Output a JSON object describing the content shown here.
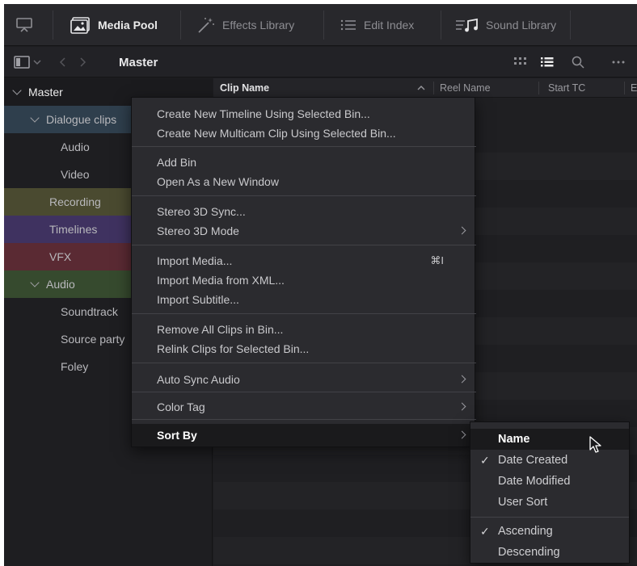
{
  "toolbar": {
    "tabs": [
      {
        "label": "Media Pool",
        "icon": "media-pool-icon",
        "active": true
      },
      {
        "label": "Effects Library",
        "icon": "effects-wand-icon",
        "active": false
      },
      {
        "label": "Edit Index",
        "icon": "list-index-icon",
        "active": false
      },
      {
        "label": "Sound Library",
        "icon": "music-note-icon",
        "active": false
      }
    ]
  },
  "subbar": {
    "title": "Master"
  },
  "columns": {
    "clip_name": "Clip Name",
    "reel_name": "Reel Name",
    "start_tc": "Start TC",
    "end_tc": "E"
  },
  "sidebar": {
    "items": [
      {
        "label": "Master"
      },
      {
        "label": "Dialogue clips"
      },
      {
        "label": "Audio"
      },
      {
        "label": "Video"
      },
      {
        "label": "Recording"
      },
      {
        "label": "Timelines"
      },
      {
        "label": "VFX"
      },
      {
        "label": "Audio"
      },
      {
        "label": "Soundtrack"
      },
      {
        "label": "Source party"
      },
      {
        "label": "Foley"
      }
    ]
  },
  "context_menu": {
    "items": [
      {
        "label": "Create New Timeline Using Selected Bin..."
      },
      {
        "label": "Create New Multicam Clip Using Selected Bin..."
      },
      {
        "label": "Add Bin"
      },
      {
        "label": "Open As a New Window"
      },
      {
        "label": "Stereo 3D Sync..."
      },
      {
        "label": "Stereo 3D Mode"
      },
      {
        "label": "Import Media...",
        "shortcut": "⌘I"
      },
      {
        "label": "Import Media from XML..."
      },
      {
        "label": "Import Subtitle..."
      },
      {
        "label": "Remove All Clips in Bin..."
      },
      {
        "label": "Relink Clips for Selected Bin..."
      },
      {
        "label": "Auto Sync Audio"
      },
      {
        "label": "Color Tag"
      },
      {
        "label": "Sort By"
      }
    ]
  },
  "sort_submenu": {
    "items": [
      {
        "label": "Name",
        "checked": false
      },
      {
        "label": "Date Created",
        "checked": true
      },
      {
        "label": "Date Modified",
        "checked": false
      },
      {
        "label": "User Sort",
        "checked": false
      },
      {
        "label": "Ascending",
        "checked": true
      },
      {
        "label": "Descending",
        "checked": false
      }
    ]
  },
  "colors": {
    "dialogue_bin": "#2f3f4d",
    "recording_bin": "#4a4a30",
    "timelines_bin": "#3f3260",
    "vfx_bin": "#5a2a33",
    "audio_bin": "#364a2e",
    "menu_bg": "#2b2b2f",
    "highlight": "#1a1a1c"
  }
}
